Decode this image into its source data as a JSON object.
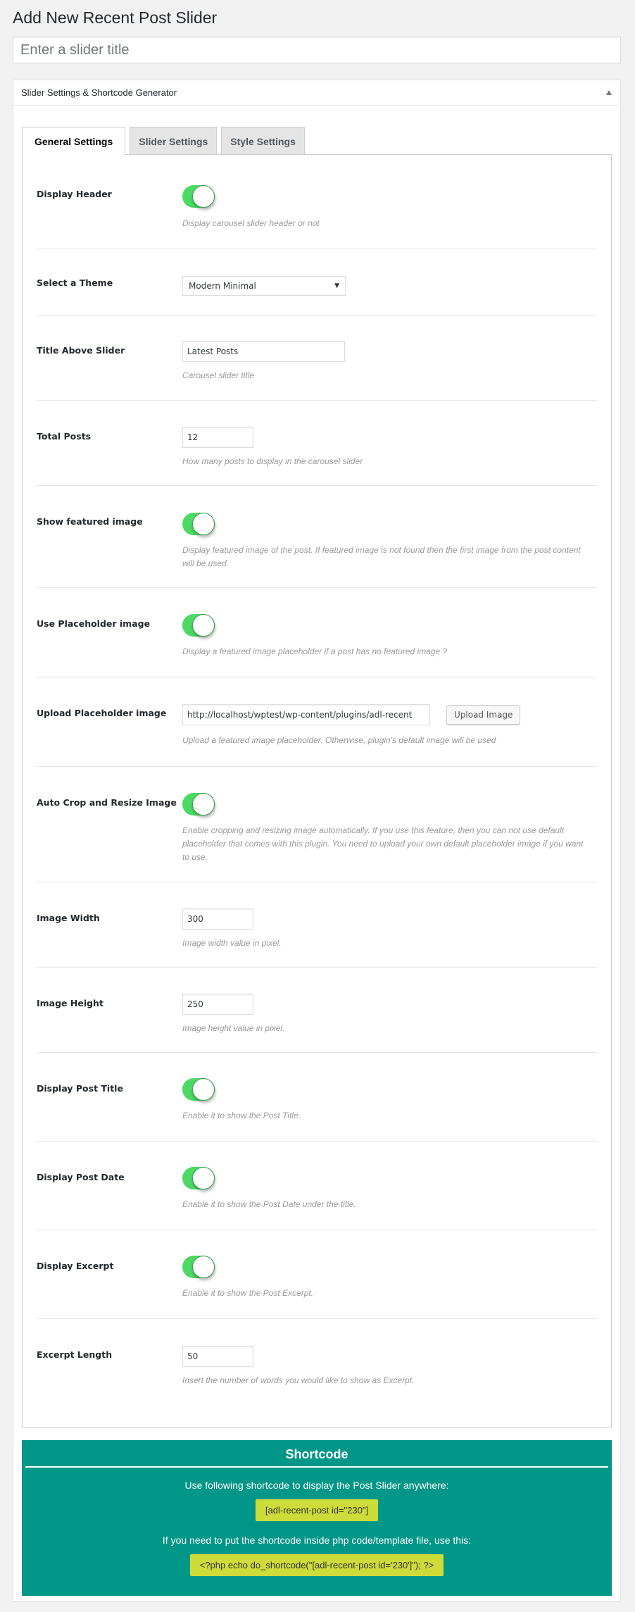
{
  "page": {
    "title": "Add New Recent Post Slider",
    "title_input_placeholder": "Enter a slider title",
    "title_input_value": ""
  },
  "postbox": {
    "title": "Slider Settings & Shortcode Generator",
    "toggle_icon": "triangle-up-icon"
  },
  "tabs": [
    {
      "label": "General Settings",
      "active": true
    },
    {
      "label": "Slider Settings",
      "active": false
    },
    {
      "label": "Style Settings",
      "active": false
    }
  ],
  "settings": {
    "display_header": {
      "label": "Display Header",
      "enabled": true,
      "description": "Display carousel slider header or not"
    },
    "theme": {
      "label": "Select a Theme",
      "selected": "Modern Minimal"
    },
    "title_above": {
      "label": "Title Above Slider",
      "value": "Latest Posts",
      "description": "Carousel slider title"
    },
    "total_posts": {
      "label": "Total Posts",
      "value": "12",
      "description": "How many posts to display in the carousel slider"
    },
    "show_featured": {
      "label": "Show featured image",
      "enabled": true,
      "description": "Display featured image of the post. If featured image is not found then the first image from the post content will be used."
    },
    "use_placeholder": {
      "label": "Use Placeholder image",
      "enabled": true,
      "description": "Display a featured image placeholder if a post has no featured image ?"
    },
    "upload_placeholder": {
      "label": "Upload Placeholder image",
      "value": "http://localhost/wptest/wp-content/plugins/adl-recent",
      "button": "Upload Image",
      "description": "Upload a featured image placeholder. Otherwise, plugin's default image will be used"
    },
    "auto_crop": {
      "label": "Auto Crop and Resize Image",
      "enabled": true,
      "description": "Enable cropping and resizing image automatically. If you use this feature, then you can not use default placeholder that comes with this plugin. You need to upload your own default placeholder image if you want to use."
    },
    "image_width": {
      "label": "Image Width",
      "value": "300",
      "description": "Image width value in pixel."
    },
    "image_height": {
      "label": "Image Height",
      "value": "250",
      "description": "Image height value in pixel."
    },
    "post_title": {
      "label": "Display Post Title",
      "enabled": true,
      "description": "Enable it to show the Post Title."
    },
    "post_date": {
      "label": "Display Post Date",
      "enabled": true,
      "description": "Enable it to show the Post Date under the title."
    },
    "excerpt": {
      "label": "Display Excerpt",
      "enabled": true,
      "description": "Enable it to show the Post Excerpt."
    },
    "excerpt_length": {
      "label": "Excerpt Length",
      "value": "50",
      "description": "Insert the number of words you would like to show as Excerpt."
    }
  },
  "shortcode": {
    "title": "Shortcode",
    "instruction": "Use following shortcode to display the Post Slider anywhere:",
    "code": "[adl-recent-post id=\"230\"]",
    "php_instruction": "If you need to put the shortcode inside php code/template file, use this:",
    "php_code": "<?php echo do_shortcode(\"[adl-recent-post id='230']\"); ?>"
  },
  "colors": {
    "toggle_on": "#4cd964",
    "shortcode_bg": "#009688",
    "code_bg": "#cddc39"
  }
}
